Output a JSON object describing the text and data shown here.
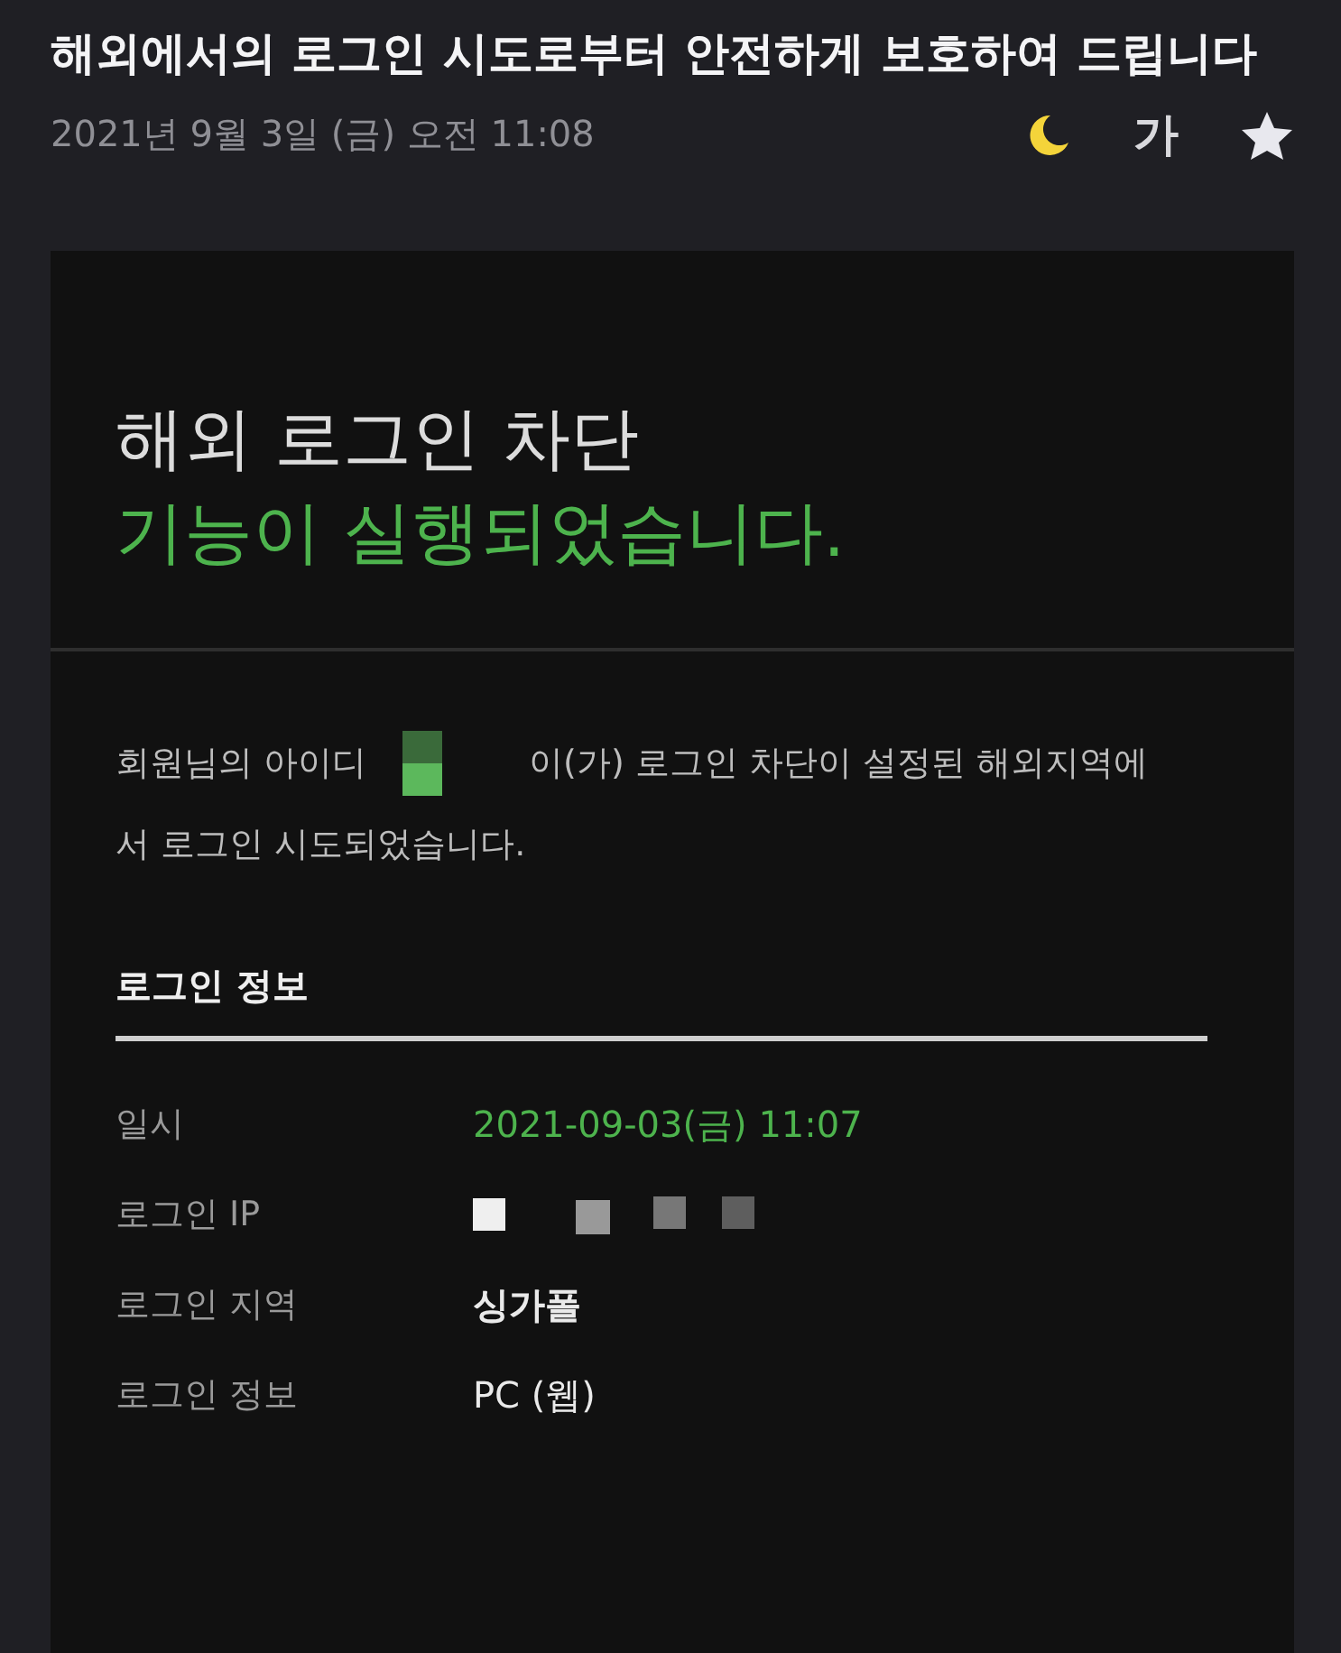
{
  "mail": {
    "subject": "해외에서의 로그인 시도로부터 안전하게 보호하여 드립니다",
    "date": "2021년 9월 3일 (금) 오전 11:08",
    "toolbar": [
      {
        "kind": "moon"
      },
      {
        "kind": "font",
        "label": "가"
      },
      {
        "kind": "star"
      }
    ]
  },
  "card": {
    "headline": "해외 로그인 차단",
    "headline_accent": "기능이 실행되었습니다.",
    "message_before": "회원님의 아이디",
    "message_after": "이(가) 로그인 차단이 설정된 해외지역에",
    "message_line2": "서 로그인 시도되었습니다.",
    "section_title": "로그인 정보",
    "rows": [
      {
        "label": "일시",
        "kind": "highlight",
        "value": "2021-09-03(금) 11:07"
      },
      {
        "label": "로그인 IP",
        "kind": "redacted"
      },
      {
        "label": "로그인 지역",
        "kind": "strong",
        "value": "싱가폴"
      },
      {
        "label": "로그인 정보",
        "kind": "plain",
        "value": "PC (웹)"
      }
    ]
  }
}
